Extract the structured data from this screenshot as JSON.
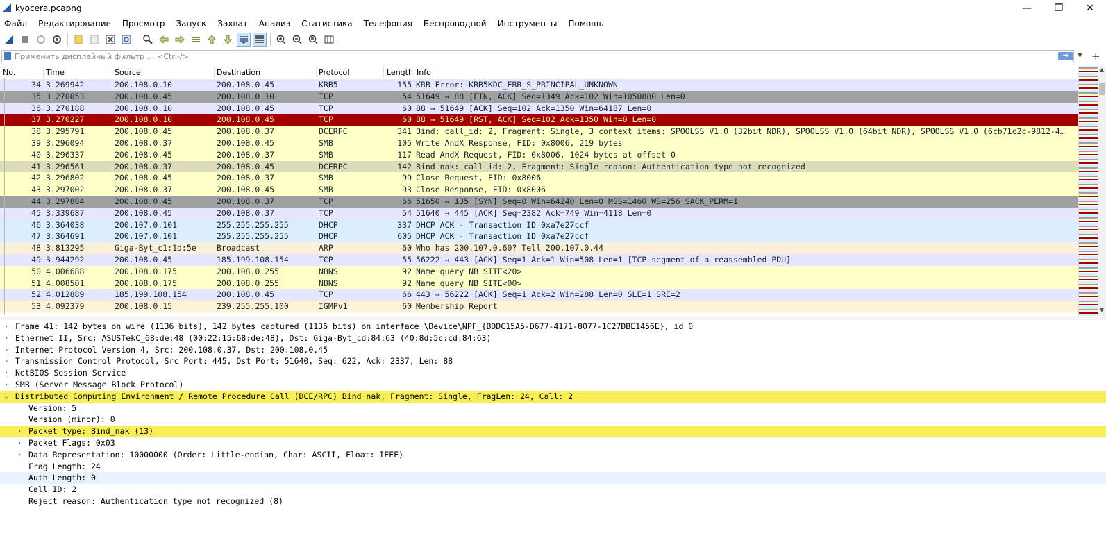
{
  "window": {
    "title": "kyocera.pcapng",
    "minimize": "—",
    "maximize": "❐",
    "close": "✕"
  },
  "menu": [
    "Файл",
    "Редактирование",
    "Просмотр",
    "Запуск",
    "Захват",
    "Анализ",
    "Статистика",
    "Телефония",
    "Беспроводной",
    "Инструменты",
    "Помощь"
  ],
  "filter": {
    "placeholder": "Применить дисплейный фильтр … <Ctrl-/>",
    "apply_icon": "➡",
    "dropdown_icon": "▼",
    "add_icon": "+"
  },
  "columns": [
    "No.",
    "Time",
    "Source",
    "Destination",
    "Protocol",
    "Length",
    "Info"
  ],
  "packets": [
    {
      "no": "34",
      "time": "3.269942",
      "src": "200.108.0.10",
      "dst": "200.108.0.45",
      "proto": "KRB5",
      "len": "155",
      "info": "KRB Error: KRB5KDC_ERR_S_PRINCIPAL_UNKNOWN",
      "bg": "#e7e6ff",
      "fg": "#12272e"
    },
    {
      "no": "35",
      "time": "3.270053",
      "src": "200.108.0.45",
      "dst": "200.108.0.10",
      "proto": "TCP",
      "len": "54",
      "info": "51649 → 88 [FIN, ACK] Seq=1349 Ack=102 Win=1050880 Len=0",
      "bg": "#a0a0a0",
      "fg": "#12272e"
    },
    {
      "no": "36",
      "time": "3.270188",
      "src": "200.108.0.10",
      "dst": "200.108.0.45",
      "proto": "TCP",
      "len": "60",
      "info": "88 → 51649 [ACK] Seq=102 Ack=1350 Win=64187 Len=0",
      "bg": "#e7e6ff",
      "fg": "#12272e"
    },
    {
      "no": "37",
      "time": "3.270227",
      "src": "200.108.0.10",
      "dst": "200.108.0.45",
      "proto": "TCP",
      "len": "60",
      "info": "88 → 51649 [RST, ACK] Seq=102 Ack=1350 Win=0 Len=0",
      "bg": "#a40000",
      "fg": "#fffc9c"
    },
    {
      "no": "38",
      "time": "3.295791",
      "src": "200.108.0.45",
      "dst": "200.108.0.37",
      "proto": "DCERPC",
      "len": "341",
      "info": "Bind: call_id: 2, Fragment: Single, 3 context items: SPOOLSS V1.0 (32bit NDR), SPOOLSS V1.0 (64bit NDR), SPOOLSS V1.0 (6cb71c2c-9812-4…",
      "bg": "#ffffc8",
      "fg": "#12272e"
    },
    {
      "no": "39",
      "time": "3.296094",
      "src": "200.108.0.37",
      "dst": "200.108.0.45",
      "proto": "SMB",
      "len": "105",
      "info": "Write AndX Response, FID: 0x8006, 219 bytes",
      "bg": "#ffffc8",
      "fg": "#12272e"
    },
    {
      "no": "40",
      "time": "3.296337",
      "src": "200.108.0.45",
      "dst": "200.108.0.37",
      "proto": "SMB",
      "len": "117",
      "info": "Read AndX Request, FID: 0x8006, 1024 bytes at offset 0",
      "bg": "#ffffc8",
      "fg": "#12272e"
    },
    {
      "no": "41",
      "time": "3.296561",
      "src": "200.108.0.37",
      "dst": "200.108.0.45",
      "proto": "DCERPC",
      "len": "142",
      "info": "Bind_nak: call_id: 2, Fragment: Single reason: Authentication type not recognized",
      "bg": "#dcdcb8",
      "fg": "#12272e"
    },
    {
      "no": "42",
      "time": "3.296802",
      "src": "200.108.0.45",
      "dst": "200.108.0.37",
      "proto": "SMB",
      "len": "99",
      "info": "Close Request, FID: 0x8006",
      "bg": "#ffffc8",
      "fg": "#12272e"
    },
    {
      "no": "43",
      "time": "3.297002",
      "src": "200.108.0.37",
      "dst": "200.108.0.45",
      "proto": "SMB",
      "len": "93",
      "info": "Close Response, FID: 0x8006",
      "bg": "#ffffc8",
      "fg": "#12272e"
    },
    {
      "no": "44",
      "time": "3.297884",
      "src": "200.108.0.45",
      "dst": "200.108.0.37",
      "proto": "TCP",
      "len": "66",
      "info": "51650 → 135 [SYN] Seq=0 Win=64240 Len=0 MSS=1460 WS=256 SACK_PERM=1",
      "bg": "#a0a0a0",
      "fg": "#12272e"
    },
    {
      "no": "45",
      "time": "3.339687",
      "src": "200.108.0.45",
      "dst": "200.108.0.37",
      "proto": "TCP",
      "len": "54",
      "info": "51640 → 445 [ACK] Seq=2382 Ack=749 Win=4118 Len=0",
      "bg": "#e7e6ff",
      "fg": "#12272e"
    },
    {
      "no": "46",
      "time": "3.364038",
      "src": "200.107.0.101",
      "dst": "255.255.255.255",
      "proto": "DHCP",
      "len": "337",
      "info": "DHCP ACK      - Transaction ID 0xa7e27ccf",
      "bg": "#daeeff",
      "fg": "#12272e"
    },
    {
      "no": "47",
      "time": "3.364691",
      "src": "200.107.0.101",
      "dst": "255.255.255.255",
      "proto": "DHCP",
      "len": "605",
      "info": "DHCP ACK      - Transaction ID 0xa7e27ccf",
      "bg": "#daeeff",
      "fg": "#12272e"
    },
    {
      "no": "48",
      "time": "3.813295",
      "src": "Giga-Byt_c1:1d:5e",
      "dst": "Broadcast",
      "proto": "ARP",
      "len": "60",
      "info": "Who has 200.107.0.60? Tell 200.107.0.44",
      "bg": "#faf0d7",
      "fg": "#12272e"
    },
    {
      "no": "49",
      "time": "3.944292",
      "src": "200.108.0.45",
      "dst": "185.199.108.154",
      "proto": "TCP",
      "len": "55",
      "info": "56222 → 443 [ACK] Seq=1 Ack=1 Win=508 Len=1 [TCP segment of a reassembled PDU]",
      "bg": "#e7e6ff",
      "fg": "#12272e"
    },
    {
      "no": "50",
      "time": "4.006688",
      "src": "200.108.0.175",
      "dst": "200.108.0.255",
      "proto": "NBNS",
      "len": "92",
      "info": "Name query NB SITE<20>",
      "bg": "#ffffc8",
      "fg": "#12272e"
    },
    {
      "no": "51",
      "time": "4.008501",
      "src": "200.108.0.175",
      "dst": "200.108.0.255",
      "proto": "NBNS",
      "len": "92",
      "info": "Name query NB SITE<00>",
      "bg": "#ffffc8",
      "fg": "#12272e"
    },
    {
      "no": "52",
      "time": "4.012889",
      "src": "185.199.108.154",
      "dst": "200.108.0.45",
      "proto": "TCP",
      "len": "66",
      "info": "443 → 56222 [ACK] Seq=1 Ack=2 Win=288 Len=0 SLE=1 SRE=2",
      "bg": "#e7e6ff",
      "fg": "#12272e"
    },
    {
      "no": "53",
      "time": "4.092379",
      "src": "200.108.0.15",
      "dst": "239.255.255.100",
      "proto": "IGMPv1",
      "len": "60",
      "info": "Membership Report",
      "bg": "#fff3d6",
      "fg": "#12272e"
    }
  ],
  "details": [
    {
      "arrow": "›",
      "indent": 0,
      "text": "Frame 41: 142 bytes on wire (1136 bits), 142 bytes captured (1136 bits) on interface \\Device\\NPF_{BDDC15A5-D677-4171-8077-1C27DBE1456E}, id 0",
      "bg": "#ffffff"
    },
    {
      "arrow": "›",
      "indent": 0,
      "text": "Ethernet II, Src: ASUSTekC_68:de:48 (00:22:15:68:de:48), Dst: Giga-Byt_cd:84:63 (40:8d:5c:cd:84:63)",
      "bg": "#ffffff"
    },
    {
      "arrow": "›",
      "indent": 0,
      "text": "Internet Protocol Version 4, Src: 200.108.0.37, Dst: 200.108.0.45",
      "bg": "#ffffff"
    },
    {
      "arrow": "›",
      "indent": 0,
      "text": "Transmission Control Protocol, Src Port: 445, Dst Port: 51640, Seq: 622, Ack: 2337, Len: 88",
      "bg": "#ffffff"
    },
    {
      "arrow": "›",
      "indent": 0,
      "text": "NetBIOS Session Service",
      "bg": "#ffffff"
    },
    {
      "arrow": "›",
      "indent": 0,
      "text": "SMB (Server Message Block Protocol)",
      "bg": "#ffffff"
    },
    {
      "arrow": "⌄",
      "indent": 0,
      "text": "Distributed Computing Environment / Remote Procedure Call (DCE/RPC) Bind_nak, Fragment: Single, FragLen: 24, Call: 2",
      "bg": "#f7ef55"
    },
    {
      "arrow": "",
      "indent": 1,
      "text": "Version: 5",
      "bg": "#ffffff"
    },
    {
      "arrow": "",
      "indent": 1,
      "text": "Version (minor): 0",
      "bg": "#ffffff"
    },
    {
      "arrow": "›",
      "indent": 1,
      "text": "Packet type: Bind_nak (13)",
      "bg": "#f7ef55"
    },
    {
      "arrow": "›",
      "indent": 1,
      "text": "Packet Flags: 0x03",
      "bg": "#ffffff"
    },
    {
      "arrow": "›",
      "indent": 1,
      "text": "Data Representation: 10000000 (Order: Little-endian, Char: ASCII, Float: IEEE)",
      "bg": "#ffffff"
    },
    {
      "arrow": "",
      "indent": 1,
      "text": "Frag Length: 24",
      "bg": "#ffffff"
    },
    {
      "arrow": "",
      "indent": 1,
      "text": "Auth Length: 0",
      "bg": "#e8f2fc"
    },
    {
      "arrow": "",
      "indent": 1,
      "text": "Call ID: 2",
      "bg": "#ffffff"
    },
    {
      "arrow": "",
      "indent": 1,
      "text": "Reject reason: Authentication type not recognized (8)",
      "bg": "#ffffff"
    }
  ],
  "colors": {
    "accent": "#4479c0",
    "selected_row": "#dcdcb8",
    "highlight": "#f7ef55",
    "rst_row": "#a40000"
  },
  "toolbar_icons": [
    "shark-fin-start-icon",
    "stop-icon",
    "restart-icon",
    "capture-options-icon",
    "open-file-icon",
    "save-file-icon",
    "close-file-icon",
    "reload-file-icon",
    "find-packet-icon",
    "go-back-icon",
    "go-forward-icon",
    "go-to-packet-icon",
    "first-packet-icon",
    "last-packet-icon",
    "auto-scroll-icon",
    "colorize-icon",
    "zoom-in-icon",
    "zoom-out-icon",
    "zoom-normal-icon",
    "resize-columns-icon"
  ]
}
